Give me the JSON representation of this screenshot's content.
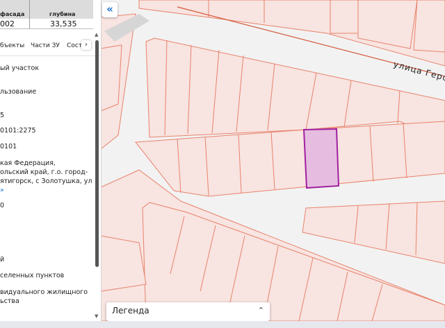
{
  "table": {
    "col1_header": "фасада",
    "col2_header": "глубина",
    "col1_value": "002",
    "col2_value": "33,535"
  },
  "tabs": {
    "objects": "бъекты",
    "parts": "Части ЗУ",
    "composition": "Состав",
    "next_arrow": "›"
  },
  "details": {
    "line1": "ый участок",
    "line2": "льзование",
    "line3": "5",
    "line4": "0101:2275",
    "line5": "0101",
    "addr1": "кая Федерация,",
    "addr2": "ольский край, г.о. город-",
    "addr3": "ятигорск, с Золотушка, ул",
    "more_link": "»",
    "line6": "0",
    "line7": "й",
    "line8": "селенных пунктов",
    "line9": "видуального жилищного",
    "line10": "ьства"
  },
  "map": {
    "street_label": "улица Геро",
    "collapse_icon": "«",
    "parcel_fill": "#f8e4e1",
    "parcel_stroke": "#e8826b",
    "selected_fill": "#e6bde0",
    "selected_stroke": "#a020a0"
  },
  "legend": {
    "label": "Легенда",
    "chevron": "⌃⌄"
  }
}
